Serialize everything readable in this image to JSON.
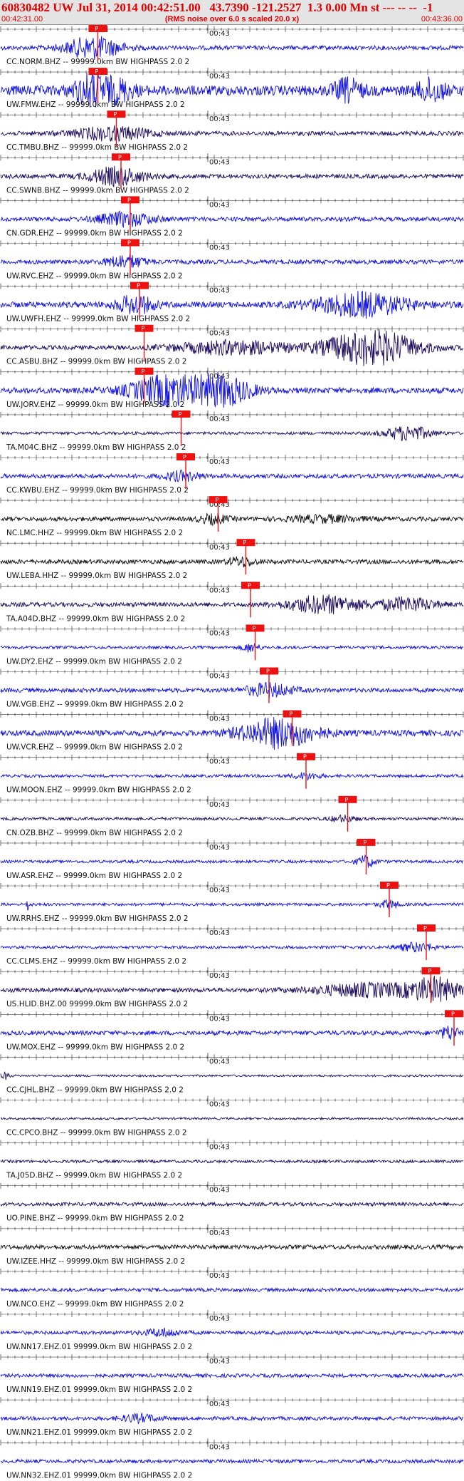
{
  "header": {
    "title": "60830482 UW Jul 31, 2014 00:42:51.00   43.7390 -121.2527  1.3 0.00 Mn st --- -- --  -1",
    "start_time": "00:42:31.00",
    "scale_note": "(RMS noise over 6.0 s scaled 20.0 x)",
    "end_time": "00:43:36.00"
  },
  "minute_label": "00:43",
  "pick_label": "P",
  "colors": {
    "blue": "#1010e0",
    "navy": "#1a0a5c",
    "black": "#101010",
    "pick": "#ee1111"
  },
  "traces": [
    {
      "label": "CC.NORM.BHZ -- 99999.0km BW  HIGHPASS  2.0  2",
      "color": "blue",
      "amp": 3,
      "pick": 0.19,
      "bursts": [
        [
          0.2,
          0.06,
          5
        ]
      ]
    },
    {
      "label": "UW.FMW.EHZ -- 99999.0km BW  HIGHPASS  2.0  2",
      "color": "blue",
      "amp": 7,
      "pick": 0.19,
      "bursts": [
        [
          0.2,
          0.04,
          3
        ],
        [
          0.26,
          0.03,
          1.6
        ],
        [
          0.75,
          0.03,
          2
        ],
        [
          0.93,
          0.03,
          2
        ]
      ]
    },
    {
      "label": "CC.TMBU.BHZ -- 99999.0km BW  HIGHPASS  2.0  2",
      "color": "navy",
      "amp": 3,
      "pick": 0.23,
      "bursts": [
        [
          0.24,
          0.08,
          3
        ]
      ]
    },
    {
      "label": "CC.SWNB.BHZ -- 99999.0km BW  HIGHPASS  2.0  2",
      "color": "navy",
      "amp": 3,
      "pick": 0.24,
      "bursts": [
        [
          0.25,
          0.06,
          4
        ]
      ]
    },
    {
      "label": "CN.GDR.EHZ -- 99999.0km BW  HIGHPASS  2.0  2",
      "color": "blue",
      "amp": 3,
      "pick": 0.26,
      "bursts": [
        [
          0.27,
          0.06,
          3
        ]
      ]
    },
    {
      "label": "UW.RVC.EHZ -- 99999.0km BW  HIGHPASS  2.0  2",
      "color": "blue",
      "amp": 3,
      "pick": 0.26,
      "bursts": [
        [
          0.27,
          0.04,
          3
        ]
      ]
    },
    {
      "label": "UW.UWFH.EHZ -- 99999.0km BW  HIGHPASS  2.0  2",
      "color": "blue",
      "amp": 4,
      "pick": 0.28,
      "bursts": [
        [
          0.29,
          0.04,
          3
        ],
        [
          0.78,
          0.1,
          4
        ]
      ]
    },
    {
      "label": "CC.ASBU.BHZ -- 99999.0km BW  HIGHPASS  2.0  2",
      "color": "navy",
      "amp": 3,
      "pick": 0.29,
      "bursts": [
        [
          0.5,
          0.12,
          3
        ],
        [
          0.8,
          0.1,
          8
        ]
      ]
    },
    {
      "label": "UW.JORV.EHZ -- 99999.0km BW  HIGHPASS  2.0  2",
      "color": "blue",
      "amp": 4,
      "pick": 0.29,
      "bursts": [
        [
          0.36,
          0.08,
          5
        ],
        [
          0.48,
          0.06,
          5
        ]
      ]
    },
    {
      "label": "TA.M04C.BHZ -- 99999.0km BW  HIGHPASS  2.0  2",
      "color": "navy",
      "amp": 2,
      "pick": 0.37,
      "bursts": [
        [
          0.88,
          0.05,
          5
        ]
      ]
    },
    {
      "label": "CC.KWBU.EHZ -- 99999.0km BW  HIGHPASS  2.0  2",
      "color": "blue",
      "amp": 3,
      "pick": 0.38,
      "bursts": [
        [
          0.39,
          0.04,
          2
        ]
      ]
    },
    {
      "label": "NC.LMC.HHZ -- 99999.0km BW  HIGHPASS  2.0  2",
      "color": "black",
      "amp": 3,
      "pick": 0.45,
      "bursts": [
        [
          0.46,
          0.03,
          2
        ],
        [
          0.7,
          0.08,
          1.4
        ]
      ]
    },
    {
      "label": "UW.LEBA.HHZ -- 99999.0km BW  HIGHPASS  2.0  2",
      "color": "black",
      "amp": 3,
      "pick": 0.51,
      "bursts": [
        [
          0.52,
          0.03,
          2
        ]
      ]
    },
    {
      "label": "TA.A04D.BHZ -- 99999.0km BW  HIGHPASS  2.0  2",
      "color": "navy",
      "amp": 3,
      "pick": 0.52,
      "bursts": [
        [
          0.7,
          0.08,
          4
        ],
        [
          0.88,
          0.06,
          3
        ]
      ]
    },
    {
      "label": "UW.DY2.EHZ -- 99999.0km BW  HIGHPASS  2.0  2",
      "color": "blue",
      "amp": 2,
      "pick": 0.53,
      "bursts": [
        [
          0.54,
          0.02,
          3
        ]
      ]
    },
    {
      "label": "UW.VGB.EHZ -- 99999.0km BW  HIGHPASS  2.0  2",
      "color": "blue",
      "amp": 3,
      "pick": 0.56,
      "bursts": [
        [
          0.58,
          0.05,
          3
        ]
      ]
    },
    {
      "label": "UW.VCR.EHZ -- 99999.0km BW  HIGHPASS  2.0  2",
      "color": "blue",
      "amp": 4,
      "pick": 0.61,
      "bursts": [
        [
          0.6,
          0.08,
          5
        ]
      ]
    },
    {
      "label": "UW.MOON.EHZ -- 99999.0km BW  HIGHPASS  2.0  2",
      "color": "blue",
      "amp": 2,
      "pick": 0.64,
      "bursts": [
        [
          0.66,
          0.03,
          2
        ]
      ]
    },
    {
      "label": "CN.OZB.BHZ -- 99999.0km BW  HIGHPASS  2.0  2",
      "color": "navy",
      "amp": 2,
      "pick": 0.73,
      "bursts": [
        [
          0.74,
          0.03,
          2
        ]
      ]
    },
    {
      "label": "UW.ASR.EHZ -- 99999.0km BW  HIGHPASS  2.0  2",
      "color": "blue",
      "amp": 2,
      "pick": 0.77,
      "bursts": [
        [
          0.79,
          0.02,
          4
        ]
      ]
    },
    {
      "label": "UW.RRHS.EHZ -- 99999.0km BW  HIGHPASS  2.0  2",
      "color": "blue",
      "amp": 2,
      "pick": 0.82,
      "bursts": [
        [
          0.84,
          0.02,
          3
        ],
        [
          0.06,
          0.005,
          4
        ]
      ]
    },
    {
      "label": "CC.CLMS.EHZ -- 99999.0km BW  HIGHPASS  2.0  2",
      "color": "blue",
      "amp": 2,
      "pick": 0.9,
      "bursts": [
        [
          0.9,
          0.04,
          3
        ]
      ]
    },
    {
      "label": "US.HLID.BHZ.00 99999.0km BW  HIGHPASS  2.0  2",
      "color": "navy",
      "amp": 3,
      "pick": 0.91,
      "bursts": [
        [
          0.8,
          0.12,
          3
        ],
        [
          0.94,
          0.05,
          5
        ]
      ]
    },
    {
      "label": "UW.MOX.EHZ -- 99999.0km BW  HIGHPASS  2.0  2",
      "color": "blue",
      "amp": 3,
      "pick": 0.96,
      "bursts": [
        [
          0.97,
          0.02,
          3
        ]
      ]
    },
    {
      "label": "CC.CJHL.BHZ -- 99999.0km BW  HIGHPASS  2.0  2",
      "color": "navy",
      "amp": 1.5,
      "pick": null,
      "bursts": [
        [
          0.01,
          0.01,
          3
        ]
      ]
    },
    {
      "label": "CC.CPCO.BHZ -- 99999.0km BW  HIGHPASS  2.0  2",
      "color": "navy",
      "amp": 1.5,
      "pick": null,
      "bursts": []
    },
    {
      "label": "TA.J05D.BHZ -- 99999.0km BW  HIGHPASS  2.0  2",
      "color": "navy",
      "amp": 2,
      "pick": null,
      "bursts": []
    },
    {
      "label": "UO.PINE.BHZ -- 99999.0km BW  HIGHPASS  2.0  2",
      "color": "navy",
      "amp": 2.5,
      "pick": null,
      "bursts": []
    },
    {
      "label": "UW.IZEE.HHZ -- 99999.0km BW  HIGHPASS  2.0  2",
      "color": "black",
      "amp": 3,
      "pick": null,
      "bursts": []
    },
    {
      "label": "UW.NCO.EHZ -- 99999.0km BW  HIGHPASS  2.0  2",
      "color": "blue",
      "amp": 2.5,
      "pick": null,
      "bursts": []
    },
    {
      "label": "UW.NN17.EHZ.01 99999.0km BW  HIGHPASS  2.0  2",
      "color": "blue",
      "amp": 2.5,
      "pick": null,
      "bursts": [
        [
          0.35,
          0.04,
          2
        ]
      ]
    },
    {
      "label": "UW.NN19.EHZ.01 99999.0km BW  HIGHPASS  2.0  2",
      "color": "blue",
      "amp": 2.5,
      "pick": null,
      "bursts": []
    },
    {
      "label": "UW.NN21.EHZ.01 99999.0km BW  HIGHPASS  2.0  2",
      "color": "blue",
      "amp": 2.5,
      "pick": null,
      "bursts": [
        [
          0.3,
          0.04,
          2
        ]
      ]
    },
    {
      "label": "UW.NN32.EHZ.01 99999.0km BW  HIGHPASS  2.0  2",
      "color": "blue",
      "amp": 2.5,
      "pick": null,
      "bursts": []
    }
  ]
}
